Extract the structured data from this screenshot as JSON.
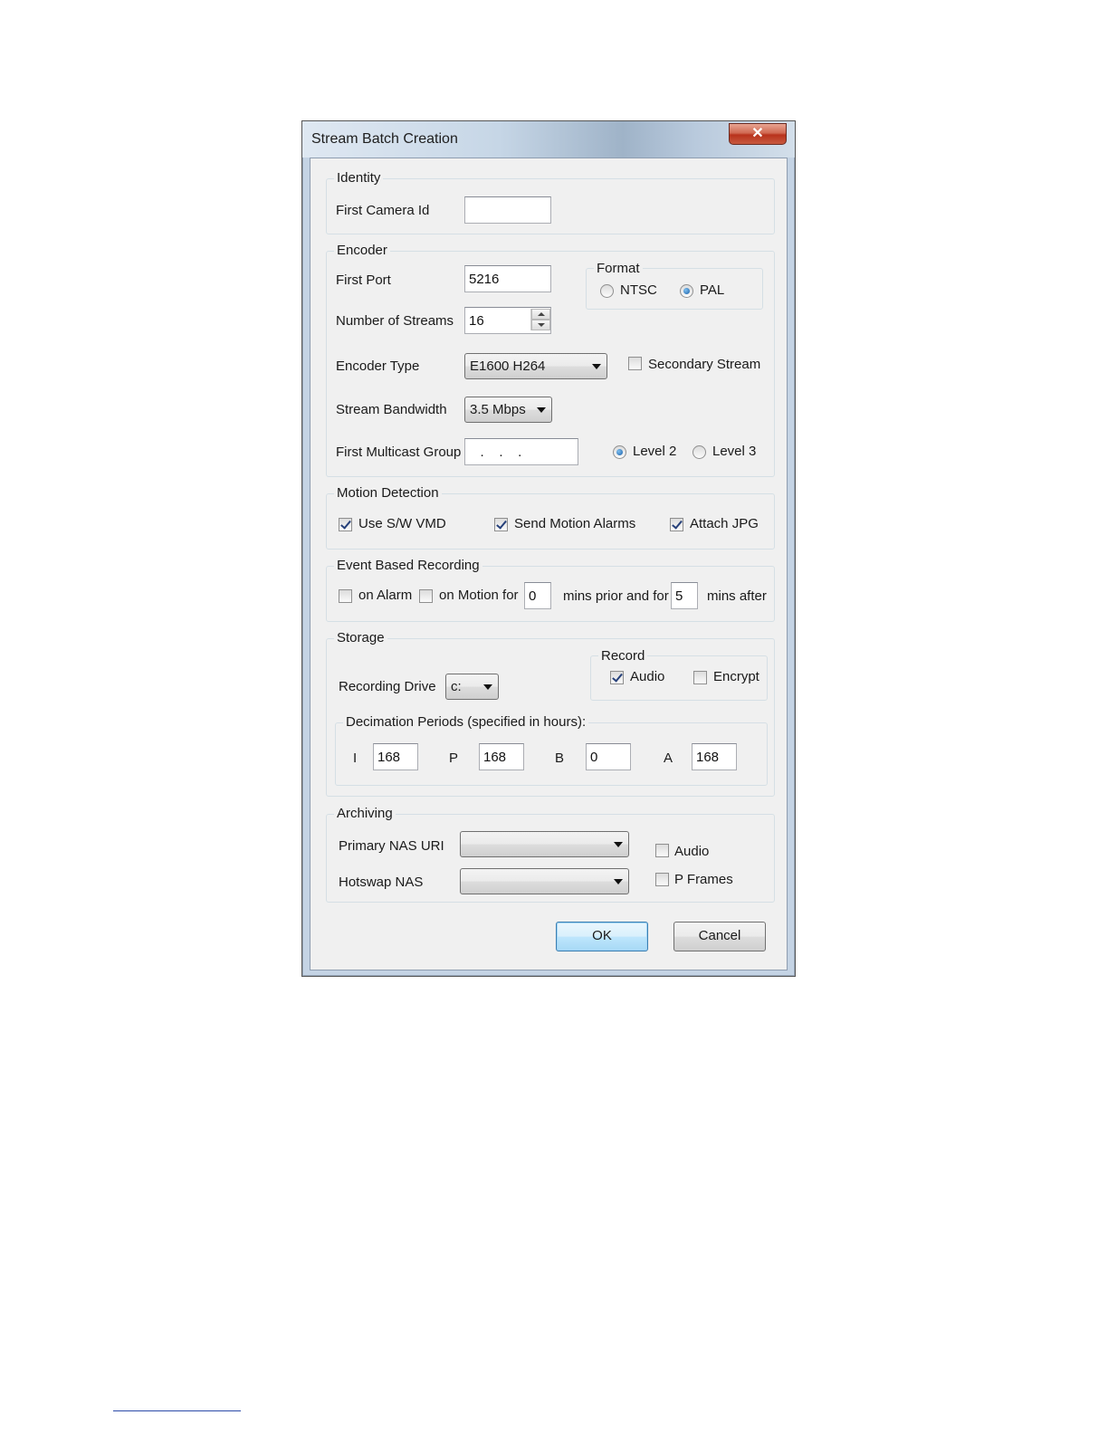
{
  "window": {
    "title": "Stream Batch Creation",
    "close_glyph": "✕"
  },
  "identity": {
    "legend": "Identity",
    "first_camera_id_label": "First Camera Id",
    "first_camera_id_value": ""
  },
  "encoder": {
    "legend": "Encoder",
    "first_port_label": "First Port",
    "first_port_value": "5216",
    "format_legend": "Format",
    "format_ntsc": "NTSC",
    "format_pal": "PAL",
    "format_selected": "PAL",
    "num_streams_label": "Number of Streams",
    "num_streams_value": "16",
    "encoder_type_label": "Encoder Type",
    "encoder_type_value": "E1600 H264",
    "secondary_stream_label": "Secondary Stream",
    "secondary_stream_checked": false,
    "bandwidth_label": "Stream Bandwidth",
    "bandwidth_value": "3.5 Mbps",
    "multicast_label": "First Multicast Group",
    "multicast_value": "   .    .    .",
    "level2_label": "Level 2",
    "level3_label": "Level 3",
    "level_selected": "Level 2"
  },
  "motion": {
    "legend": "Motion Detection",
    "use_sw_vmd_label": "Use S/W VMD",
    "use_sw_vmd_checked": true,
    "send_alarms_label": "Send Motion Alarms",
    "send_alarms_checked": true,
    "attach_jpg_label": "Attach JPG",
    "attach_jpg_checked": true
  },
  "event_recording": {
    "legend": "Event Based Recording",
    "on_alarm_label": "on Alarm",
    "on_alarm_checked": false,
    "on_motion_label": "on Motion for",
    "on_motion_checked": false,
    "prior_value": "0",
    "prior_label": "mins prior and for",
    "after_value": "5",
    "after_label": "mins after"
  },
  "storage": {
    "legend": "Storage",
    "recording_drive_label": "Recording Drive",
    "recording_drive_value": "c:",
    "record_legend": "Record",
    "audio_label": "Audio",
    "audio_checked": true,
    "encrypt_label": "Encrypt",
    "encrypt_checked": false,
    "decimation_legend": "Decimation Periods (specified in hours):",
    "i_label": "I",
    "i_value": "168",
    "p_label": "P",
    "p_value": "168",
    "b_label": "B",
    "b_value": "0",
    "a_label": "A",
    "a_value": "168"
  },
  "archiving": {
    "legend": "Archiving",
    "primary_nas_label": "Primary NAS URI",
    "primary_nas_value": "",
    "hotswap_nas_label": "Hotswap NAS",
    "hotswap_nas_value": "",
    "audio_label": "Audio",
    "audio_checked": false,
    "pframes_label": "P Frames",
    "pframes_checked": false
  },
  "buttons": {
    "ok": "OK",
    "cancel": "Cancel"
  },
  "icons": {
    "close": "close-icon",
    "dropdown": "chevron-down-icon",
    "spin_up": "spin-up-icon",
    "spin_down": "spin-down-icon",
    "checkmark": "checkmark-icon"
  }
}
